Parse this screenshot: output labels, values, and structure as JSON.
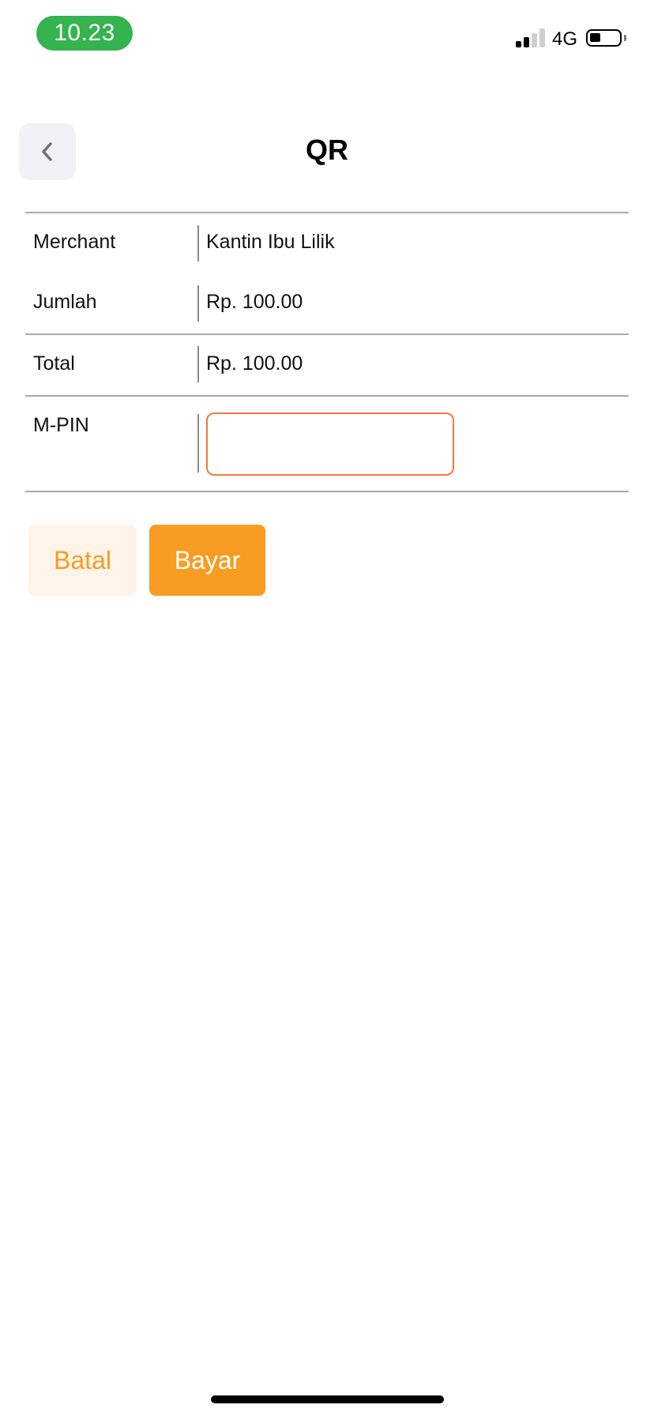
{
  "status_bar": {
    "time": "10.23",
    "network": "4G",
    "time_pill_color": "#34b34f",
    "signal_icon": "cellular-signal-icon",
    "battery_icon": "battery-icon"
  },
  "header": {
    "title": "QR",
    "back_icon": "chevron-left-icon"
  },
  "details": {
    "merchant": {
      "label": "Merchant",
      "value": "Kantin Ibu Lilik"
    },
    "amount": {
      "label": "Jumlah",
      "value": "Rp. 100.00"
    },
    "total": {
      "label": "Total",
      "value": "Rp. 100.00"
    },
    "mpin": {
      "label": "M-PIN",
      "value": "",
      "placeholder": ""
    }
  },
  "actions": {
    "cancel_label": "Batal",
    "pay_label": "Bayar",
    "accent_color": "#f89c22",
    "input_border_color": "#f07a3c"
  }
}
